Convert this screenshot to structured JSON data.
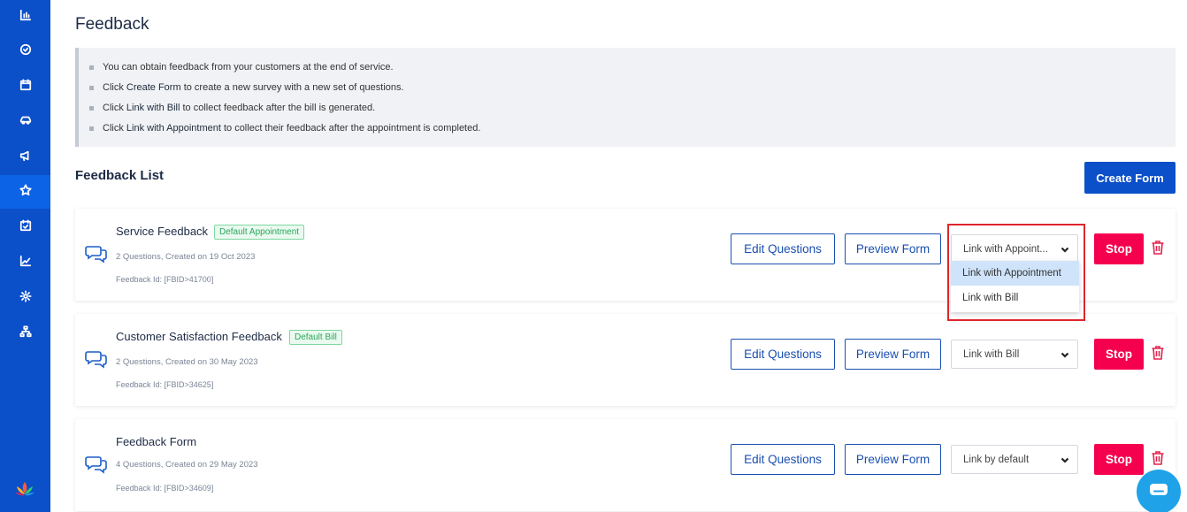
{
  "sidebar": {
    "items": [
      {
        "icon": "bar-chart-icon"
      },
      {
        "icon": "check-circle-icon"
      },
      {
        "icon": "calendar-icon"
      },
      {
        "icon": "car-icon"
      },
      {
        "icon": "megaphone-icon"
      },
      {
        "icon": "star-icon",
        "active": true
      },
      {
        "icon": "calendar-check-icon"
      },
      {
        "icon": "trend-chart-icon"
      },
      {
        "icon": "gear-icon"
      },
      {
        "icon": "hierarchy-icon"
      }
    ],
    "logo": "lotus-logo"
  },
  "header": {
    "title": "Feedback"
  },
  "info": {
    "lines": [
      {
        "pre": "You can obtain feedback from your customers at the end of service.",
        "bold": "",
        "post": ""
      },
      {
        "pre": "Click ",
        "bold": "Create Form",
        "post": " to create a new survey with a new set of questions."
      },
      {
        "pre": "Click ",
        "bold": "Link with Bill",
        "post": " to collect feedback after the bill is generated."
      },
      {
        "pre": "Click ",
        "bold": "Link with Appointment",
        "post": " to collect their feedback after the appointment is completed."
      }
    ]
  },
  "list": {
    "title": "Feedback List",
    "create_label": "Create Form",
    "edit_label": "Edit Questions",
    "preview_label": "Preview Form",
    "stop_label": "Stop",
    "cards": [
      {
        "name": "Service Feedback",
        "badge": "Default Appointment",
        "meta": "2 Questions, Created on 19 Oct 2023",
        "fid": "Feedback Id: [FBID>41700]",
        "link": "Link with Appoint..."
      },
      {
        "name": "Customer Satisfaction Feedback",
        "badge": "Default Bill",
        "meta": "2 Questions, Created on 30 May 2023",
        "fid": "Feedback Id: [FBID>34625]",
        "link": "Link with Bill"
      },
      {
        "name": "Feedback Form",
        "badge": "",
        "meta": "4 Questions, Created on 29 May 2023",
        "fid": "Feedback Id: [FBID>34609]",
        "link": "Link by default"
      }
    ]
  },
  "dropdown": {
    "options": [
      "Link with Appointment",
      "Link with Bill"
    ],
    "selected_index": 0
  },
  "colors": {
    "sidebar": "#0b4fc9",
    "primary": "#0b4fc9",
    "stop": "#f5004f",
    "badge_green": "#2aa55a",
    "highlight": "#e0252c"
  }
}
